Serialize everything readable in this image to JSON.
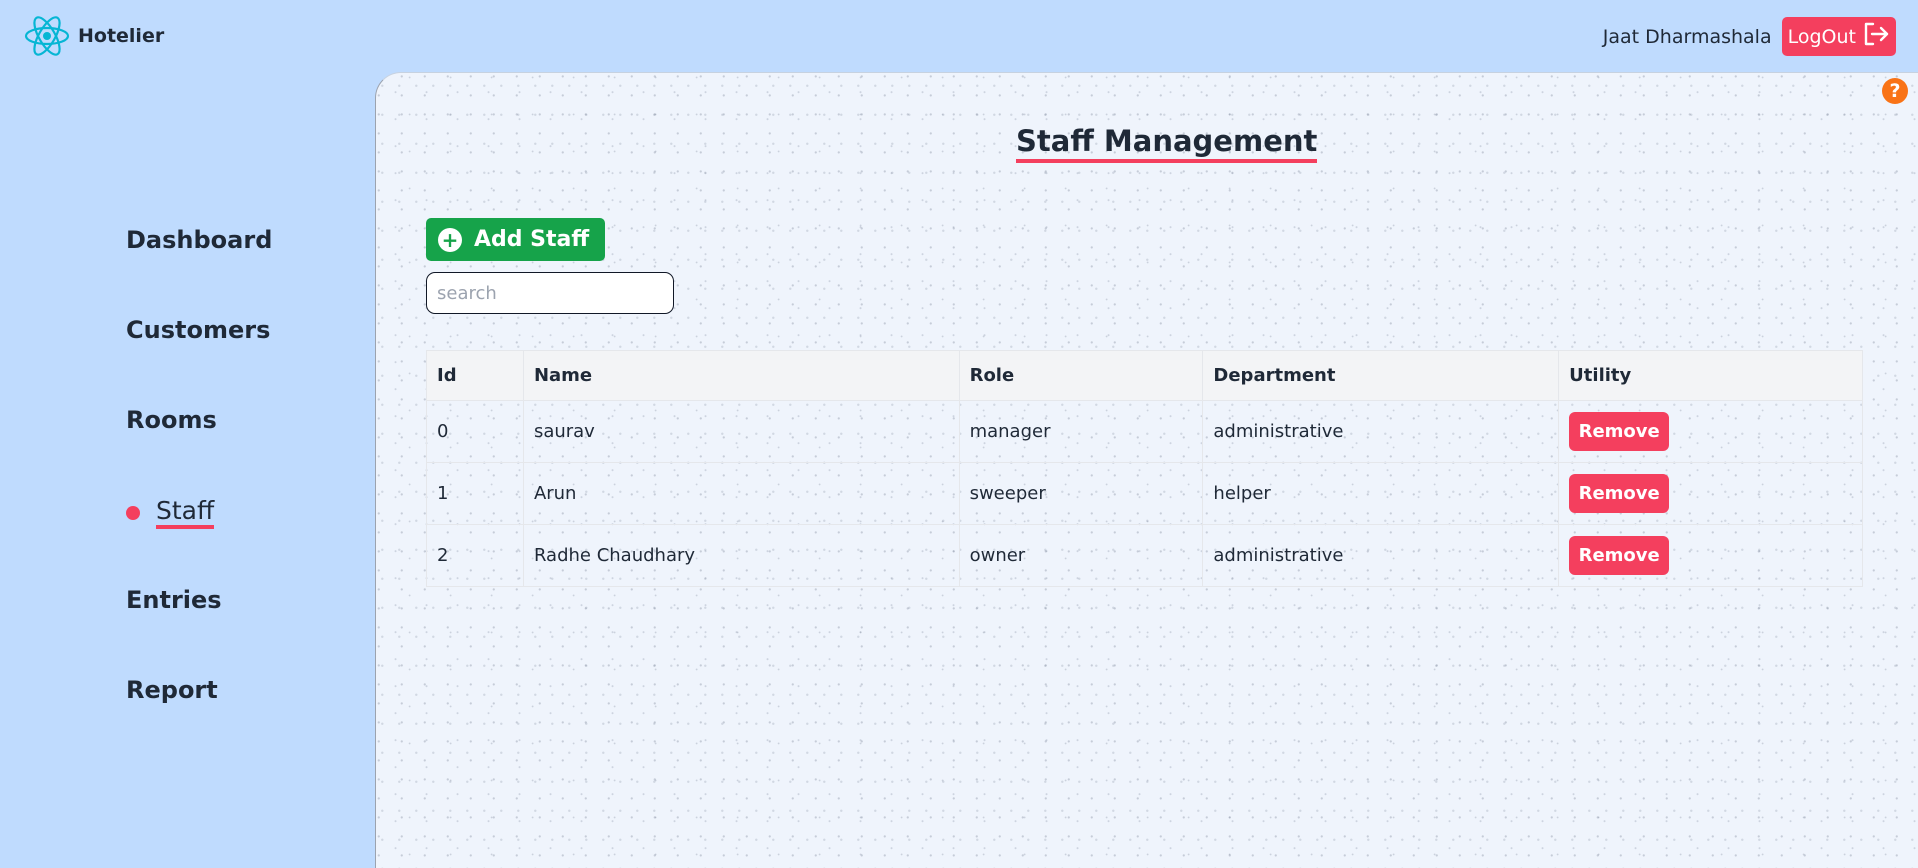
{
  "header": {
    "app_name": "Hotelier",
    "user_name": "Jaat Dharmashala",
    "logout_label": "LogOut"
  },
  "sidebar": {
    "items": [
      {
        "label": "Dashboard"
      },
      {
        "label": "Customers"
      },
      {
        "label": "Rooms"
      },
      {
        "label": "Staff",
        "active": true
      },
      {
        "label": "Entries"
      },
      {
        "label": "Report"
      }
    ]
  },
  "main": {
    "title": "Staff Management",
    "add_button_label": "Add Staff",
    "search_placeholder": "search",
    "help_label": "?"
  },
  "table": {
    "columns": [
      "Id",
      "Name",
      "Role",
      "Department",
      "Utility"
    ],
    "rows": [
      {
        "id": "0",
        "name": "saurav",
        "role": "manager",
        "department": "administrative",
        "action": "Remove"
      },
      {
        "id": "1",
        "name": "Arun",
        "role": "sweeper",
        "department": "helper",
        "action": "Remove"
      },
      {
        "id": "2",
        "name": "Radhe Chaudhary",
        "role": "owner",
        "department": "administrative",
        "action": "Remove"
      }
    ]
  },
  "colors": {
    "background": "#bfdbfe",
    "accent": "#f43f5e",
    "add_button": "#16a34a",
    "help": "#f97316",
    "logo": "#06b6d4"
  },
  "icons": {
    "logo": "react-atom-icon",
    "logout": "logout-arrow-icon",
    "add": "plus-circle-icon",
    "help": "question-circle-icon"
  }
}
